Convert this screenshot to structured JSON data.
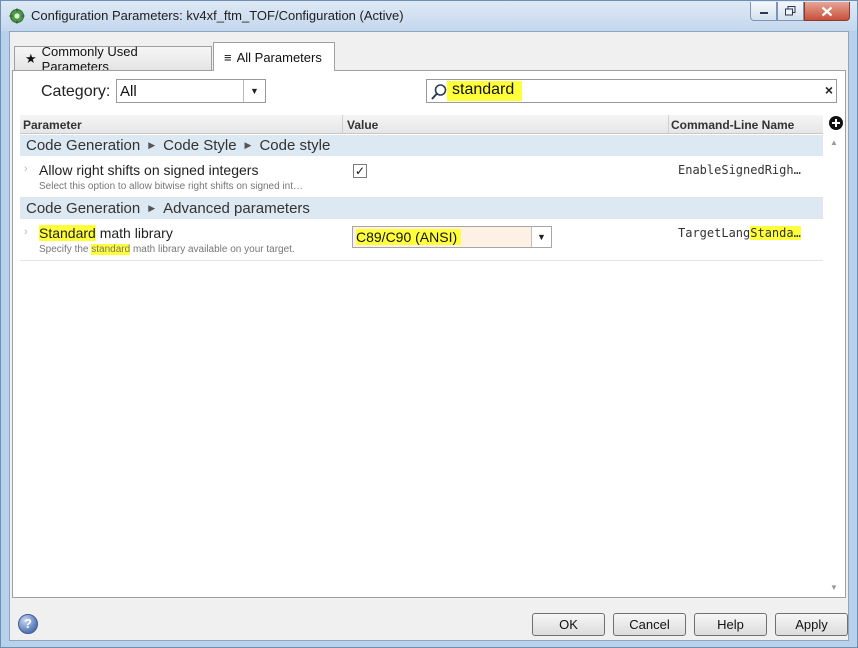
{
  "window": {
    "title": "Configuration Parameters: kv4xf_ftm_TOF/Configuration (Active)"
  },
  "tabs": [
    {
      "icon": "★",
      "label": "Commonly Used Parameters",
      "active": false
    },
    {
      "icon": "≡",
      "label": "All Parameters",
      "active": true
    }
  ],
  "filter": {
    "category_label": "Category:",
    "category_value": "All",
    "search_value": "standard"
  },
  "table": {
    "columns": [
      "Parameter",
      "Value",
      "Command-Line Name"
    ],
    "groups": [
      {
        "path": [
          "Code Generation",
          "Code Style",
          "Code style"
        ],
        "rows": [
          {
            "name": "Allow right shifts on signed integers",
            "description": "Select this option to allow bitwise right shifts on signed int…",
            "value_type": "checkbox",
            "checked": true,
            "command_line_name": "EnableSignedRigh…"
          }
        ]
      },
      {
        "path": [
          "Code Generation",
          "Advanced parameters"
        ],
        "rows": [
          {
            "name_highlight": "Standard",
            "name_rest": " math library",
            "description_prefix": "Specify the ",
            "description_highlight": "standard",
            "description_suffix": " math library available on your target.",
            "value_type": "select",
            "value": "C89/C90 (ANSI)",
            "command_line_prefix": "TargetLang",
            "command_line_highlight": "Standa…"
          }
        ]
      }
    ]
  },
  "buttons": {
    "ok": "OK",
    "cancel": "Cancel",
    "help": "Help",
    "apply": "Apply"
  },
  "colors": {
    "highlight": "#ffff3a",
    "group_row_bg": "#dce8f2",
    "selected_value_bg": "#fdf1e6"
  }
}
